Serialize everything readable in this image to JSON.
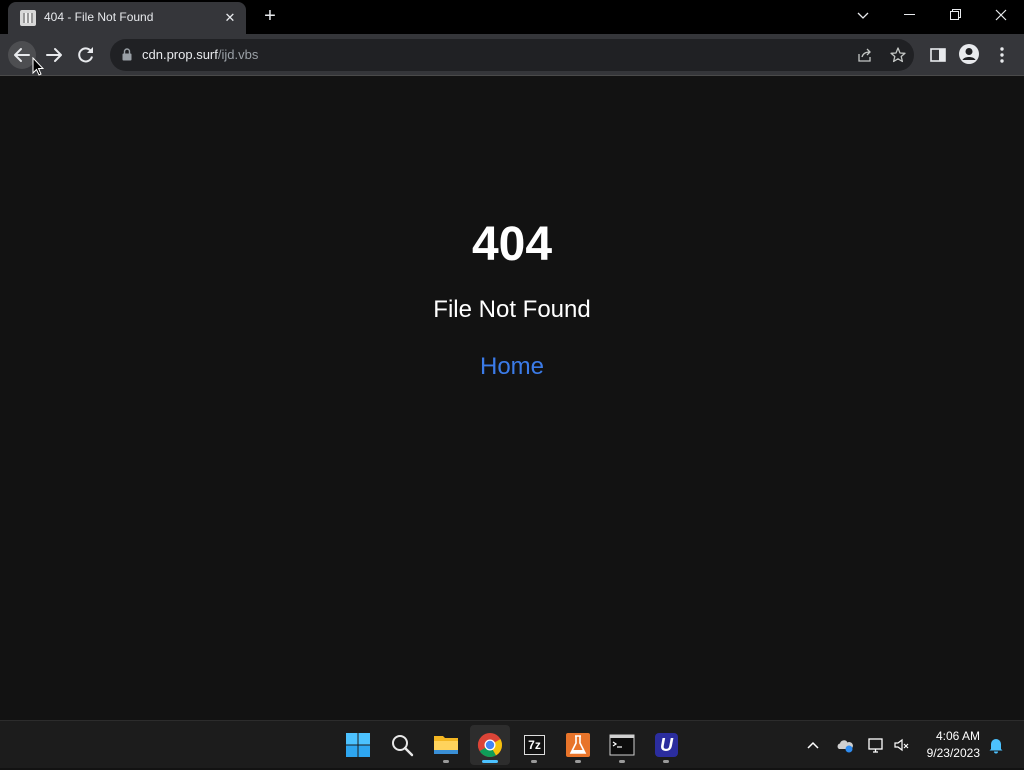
{
  "browser": {
    "tab": {
      "title": "404 - File Not Found",
      "close_glyph": "✕"
    },
    "new_tab_glyph": "+",
    "window_controls": {
      "dropdown": "⌄",
      "minimize": "─",
      "restore": "❐",
      "close": "✕"
    },
    "address": {
      "host": "cdn.prop.surf",
      "path": "/ijd.vbs"
    }
  },
  "page": {
    "error_code": "404",
    "error_message": "File Not Found",
    "home_link": "Home"
  },
  "taskbar": {
    "apps": [
      {
        "name": "start",
        "icon": "windows-logo-icon"
      },
      {
        "name": "search",
        "icon": "search-icon"
      },
      {
        "name": "file-explorer",
        "icon": "folder-icon"
      },
      {
        "name": "chrome",
        "icon": "chrome-icon",
        "active": true
      },
      {
        "name": "7zip",
        "icon": "7zip-icon",
        "label": "7z"
      },
      {
        "name": "lab-tool",
        "icon": "flask-icon"
      },
      {
        "name": "terminal",
        "icon": "terminal-icon"
      },
      {
        "name": "u-app",
        "icon": "u-app-icon",
        "label": "U"
      }
    ],
    "clock": {
      "time": "4:06 AM",
      "date": "9/23/2023"
    }
  },
  "colors": {
    "page_bg": "#121212",
    "link": "#3b7be8",
    "toolbar": "#35363a",
    "taskbar": "#1c1c1c",
    "accent": "#4cc2ff"
  }
}
